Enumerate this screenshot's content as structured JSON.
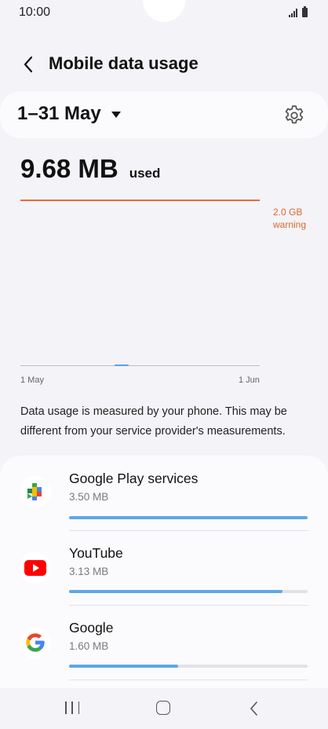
{
  "status_bar": {
    "time": "10:00"
  },
  "header": {
    "title": "Mobile data usage",
    "back_icon": "chevron-left-icon"
  },
  "period": {
    "label": "1–31 May",
    "dropdown_icon": "triangle-down-icon",
    "settings_icon": "gear-icon"
  },
  "usage": {
    "value": "9.68 MB",
    "suffix": "used"
  },
  "chart": {
    "warning_value": "2.0 GB",
    "warning_text": "warning",
    "x_start": "1 May",
    "x_end": "1 Jun",
    "warning_color": "#e46c3b",
    "usage_color": "#5b9fe8"
  },
  "note": "Data usage is measured by your phone. This may be different from your service provider's measurements.",
  "apps": [
    {
      "name": "Google Play services",
      "size": "3.50 MB",
      "fraction": 1.0,
      "icon": "google-play-services-icon"
    },
    {
      "name": "YouTube",
      "size": "3.13 MB",
      "fraction": 0.894,
      "icon": "youtube-icon"
    },
    {
      "name": "Google",
      "size": "1.60 MB",
      "fraction": 0.457,
      "icon": "google-icon"
    }
  ],
  "colors": {
    "accent_bar": "#5ea8ea",
    "background": "#f4f3f7",
    "card": "#fbfbfd"
  }
}
